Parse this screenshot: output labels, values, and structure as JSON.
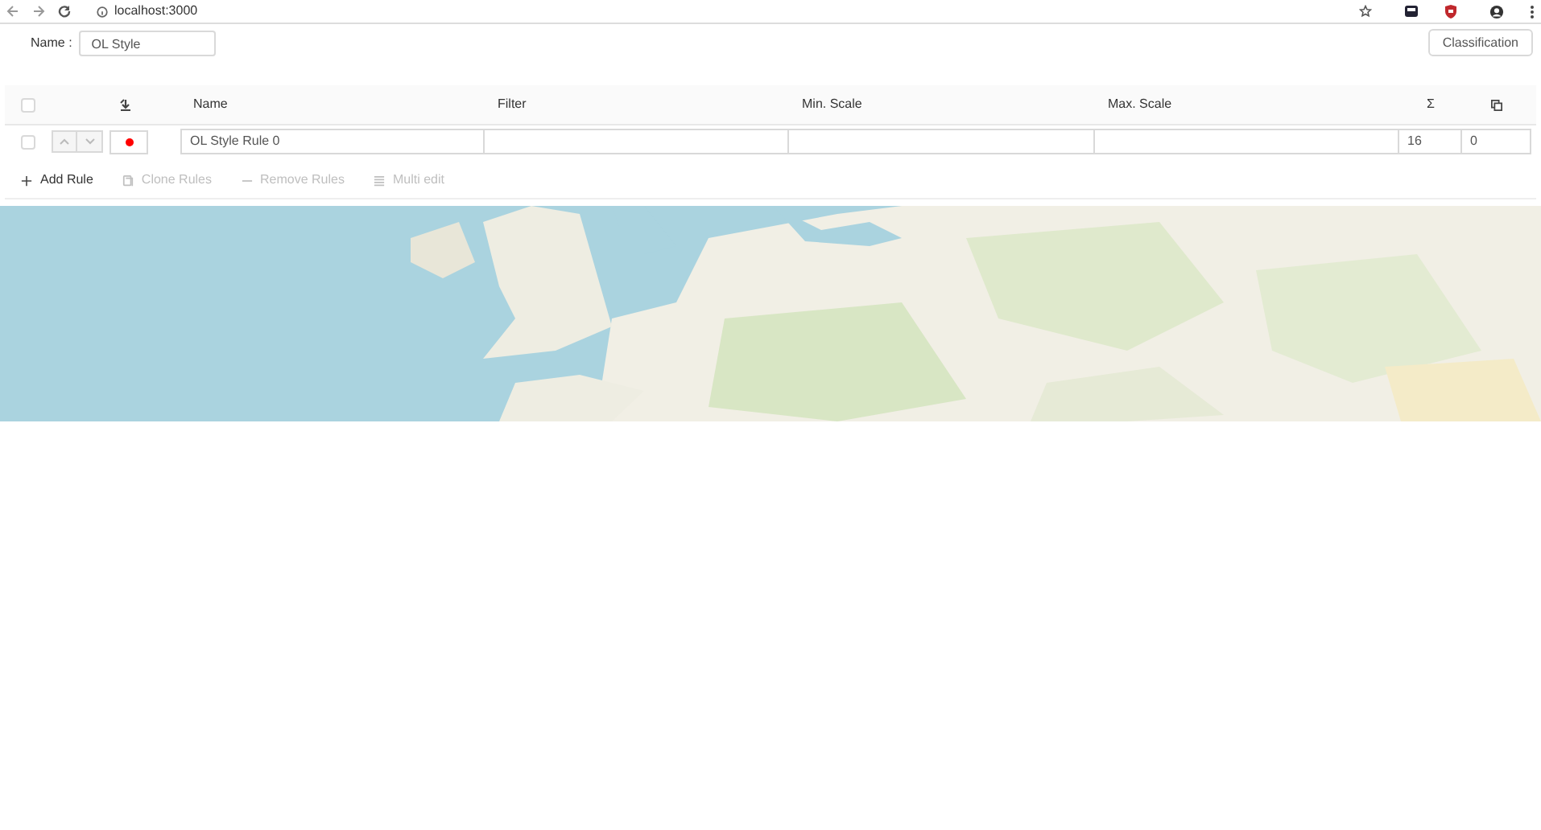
{
  "browser": {
    "url": "localhost:3000"
  },
  "style_name": {
    "label": "Name :",
    "value": "OL Style"
  },
  "classification_button": "Classification",
  "table": {
    "select_all": {
      "checked": false
    },
    "columns": [
      "Name",
      "Filter",
      "Min. Scale",
      "Max. Scale",
      "Σ"
    ],
    "rows": [
      {
        "checked": false,
        "name": "OL Style Rule 0",
        "count": "16",
        "duplicates": "0"
      }
    ]
  },
  "toolbar": [
    {
      "label": "Add Rule",
      "disabled": false
    },
    {
      "label": "Clone Rules",
      "disabled": true
    },
    {
      "label": "Remove Rules",
      "disabled": true
    },
    {
      "label": "Multi edit",
      "disabled": true
    }
  ]
}
